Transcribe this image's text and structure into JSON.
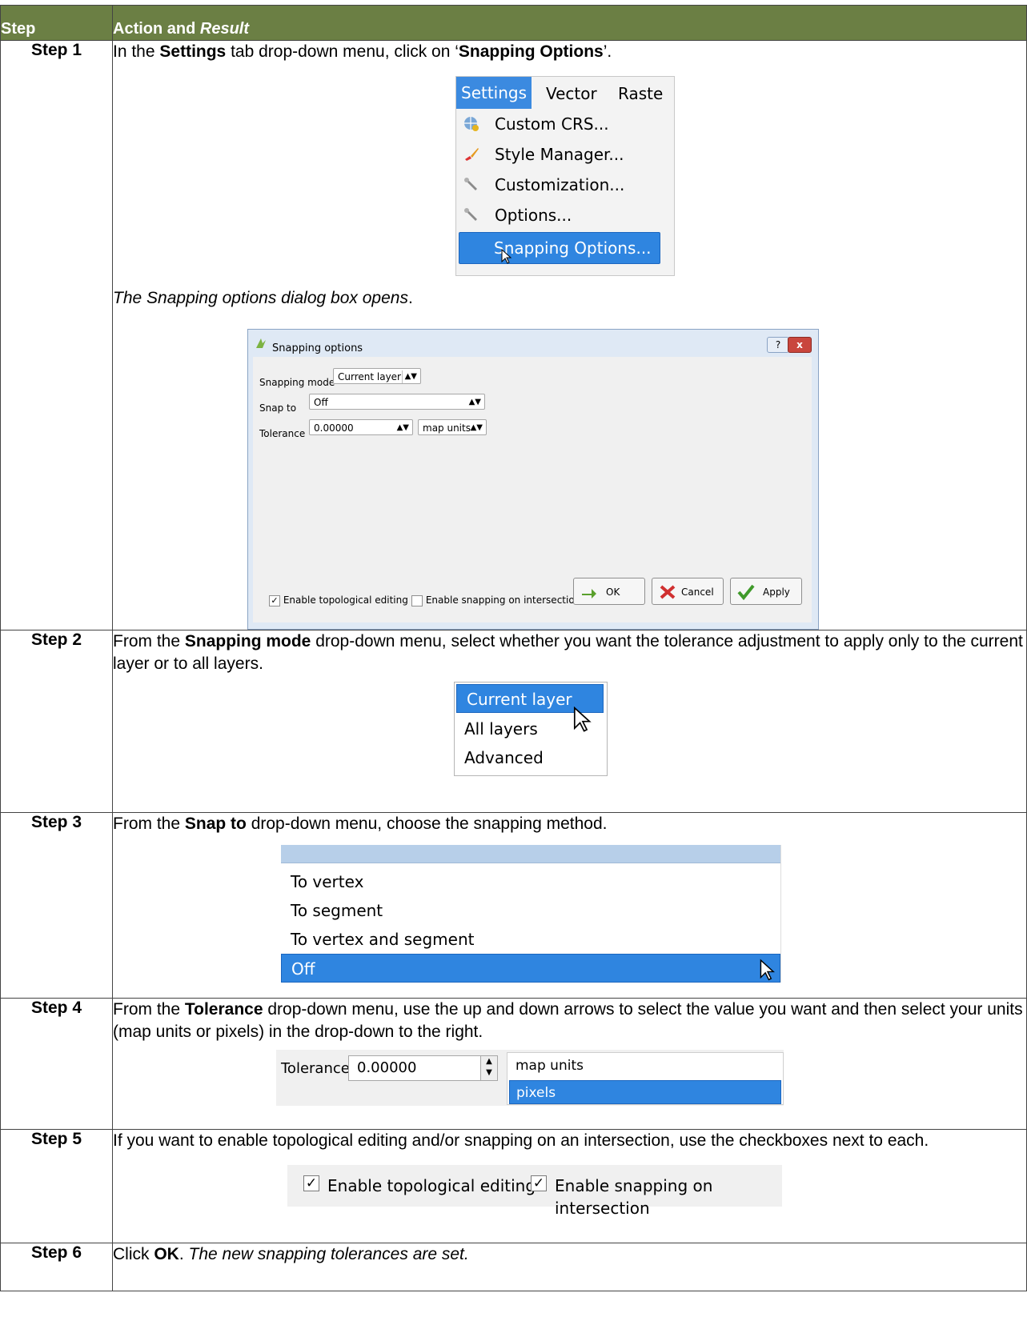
{
  "header": {
    "col_step": "Step",
    "col_action": "Action and ",
    "col_result": "Result"
  },
  "steps": [
    {
      "label": "Step 1",
      "text_parts": [
        "In the ",
        "Settings",
        " tab drop-down menu, click on ‘",
        "Snapping Options",
        "’."
      ],
      "menu": {
        "bar": [
          "Settings",
          "Vector",
          "Raste"
        ],
        "items": [
          "Custom CRS...",
          "Style Manager...",
          "Customization...",
          "Options...",
          "Snapping Options..."
        ]
      },
      "result": "The Snapping options dialog box opens",
      "result_end": ".",
      "dialog": {
        "title": "Snapping options",
        "help": "?",
        "close": "x",
        "mode_label": "Snapping mode",
        "mode_value": "Current layer",
        "snap_label": "Snap to",
        "snap_value": "Off",
        "tol_label": "Tolerance",
        "tol_value": "0.00000",
        "tol_units": "map units",
        "chk1": "Enable topological editing",
        "chk2": "Enable snapping on intersection",
        "ok": "OK",
        "cancel": "Cancel",
        "apply": "Apply"
      }
    },
    {
      "label": "Step 2",
      "text_parts": [
        "From the ",
        "Snapping mode",
        " drop-down menu, select whether you want the tolerance adjustment to apply only to the current layer or to all layers."
      ],
      "options": [
        "Current layer",
        "All layers",
        "Advanced"
      ]
    },
    {
      "label": "Step 3",
      "text_parts": [
        "From the ",
        "Snap to",
        " drop-down menu, choose the snapping method."
      ],
      "options": [
        "To vertex",
        "To segment",
        "To vertex and segment",
        "Off"
      ]
    },
    {
      "label": "Step 4",
      "text_parts": [
        "From the ",
        "Tolerance",
        " drop-down menu, use the up and down arrows to select the value you want and then select your units (map units or pixels) in the drop-down to the right."
      ],
      "tol_label": "Tolerance",
      "tol_value": "0.00000",
      "units": [
        "map units",
        "pixels"
      ]
    },
    {
      "label": "Step 5",
      "text": "If you want to enable topological editing and/or snapping on an intersection, use the checkboxes next to each.",
      "chk1": "Enable topological editing",
      "chk2": "Enable snapping on intersection"
    },
    {
      "label": "Step 6",
      "text_parts": [
        "Click ",
        "OK",
        ". ",
        "The new snapping tolerances are set."
      ]
    }
  ],
  "colors": {
    "header_bg": "#6b7f44",
    "selection": "#2f85e0"
  }
}
